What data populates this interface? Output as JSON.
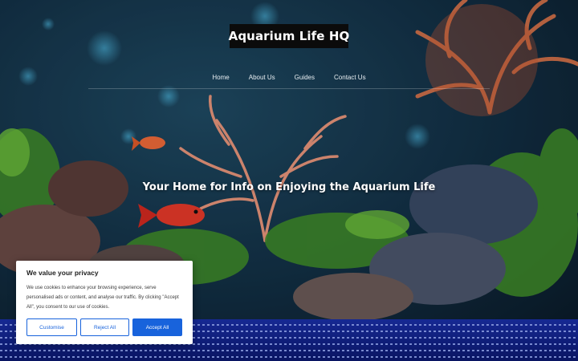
{
  "site": {
    "title": "Aquarium Life HQ",
    "tagline": "Your Home for Info on Enjoying the Aquarium Life"
  },
  "nav": {
    "items": [
      "Home",
      "About Us",
      "Guides",
      "Contact Us"
    ]
  },
  "cookie_banner": {
    "title": "We value your privacy",
    "body": "We use cookies to enhance your browsing experience, serve personalised ads or content, and analyse our traffic. By clicking \"Accept All\", you consent to our use of cookies.",
    "buttons": {
      "customise": "Customise",
      "reject": "Reject All",
      "accept": "Accept All"
    }
  },
  "colors": {
    "accent": "#1863dc",
    "title_bg": "#0b0b0b",
    "banner_bg": "#ffffff"
  }
}
